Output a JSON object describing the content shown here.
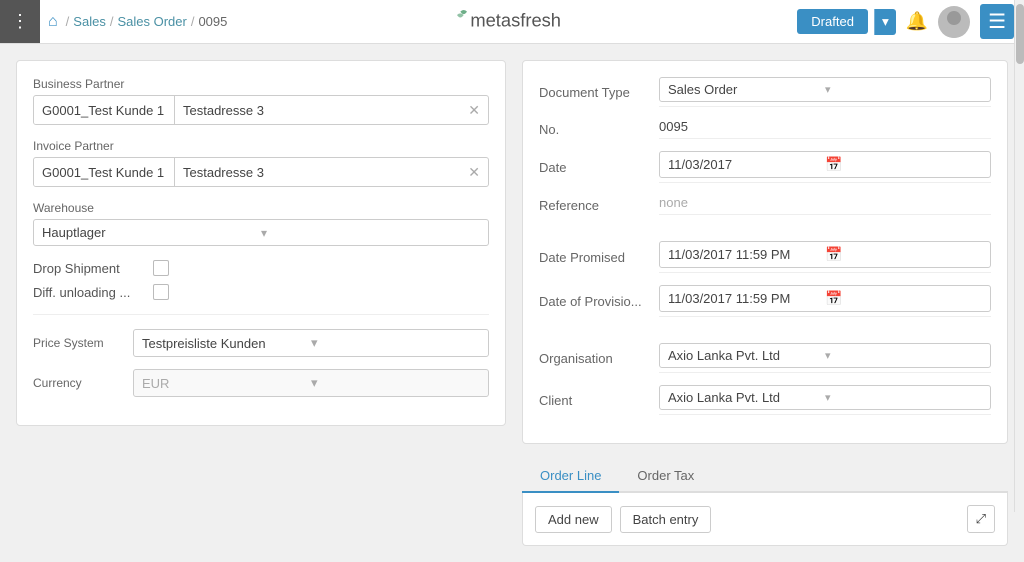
{
  "topbar": {
    "menu_icon": "⋮",
    "home_icon": "🏠",
    "breadcrumb": [
      {
        "label": "Sales",
        "sep": "/"
      },
      {
        "label": "Sales Order",
        "sep": "/"
      },
      {
        "label": "0095",
        "sep": ""
      }
    ],
    "status_label": "Drafted",
    "bell_icon": "🔔",
    "hamburger_icon": "☰",
    "caret": "▾"
  },
  "logo": {
    "text": "metasfresh"
  },
  "left_panel": {
    "business_partner_label": "Business Partner",
    "business_partner_value1": "G0001_Test Kunde 1",
    "business_partner_value2": "Testadresse 3",
    "invoice_partner_label": "Invoice Partner",
    "invoice_partner_value1": "G0001_Test Kunde 1",
    "invoice_partner_value2": "Testadresse 3",
    "warehouse_label": "Warehouse",
    "warehouse_value": "Hauptlager",
    "drop_shipment_label": "Drop Shipment",
    "diff_unloading_label": "Diff. unloading ...",
    "price_system_label": "Price System",
    "price_system_value": "Testpreisliste Kunden",
    "currency_label": "Currency",
    "currency_value": "EUR",
    "caret": "▾",
    "clear_icon": "✕"
  },
  "right_panel": {
    "document_type_label": "Document Type",
    "document_type_value": "Sales Order",
    "no_label": "No.",
    "no_value": "0095",
    "date_label": "Date",
    "date_value": "11/03/2017",
    "reference_label": "Reference",
    "reference_value": "none",
    "date_promised_label": "Date Promised",
    "date_promised_value": "11/03/2017 11:59 PM",
    "date_provision_label": "Date of Provisio...",
    "date_provision_value": "11/03/2017 11:59 PM",
    "organisation_label": "Organisation",
    "organisation_value": "Axio Lanka Pvt. Ltd",
    "client_label": "Client",
    "client_value": "Axio Lanka Pvt. Ltd",
    "calendar_icon": "📅",
    "caret": "▾"
  },
  "tabs": {
    "items": [
      {
        "label": "Order Line",
        "active": true
      },
      {
        "label": "Order Tax",
        "active": false
      }
    ],
    "add_new_label": "Add new",
    "batch_entry_label": "Batch entry",
    "expand_icon": "⤢"
  }
}
